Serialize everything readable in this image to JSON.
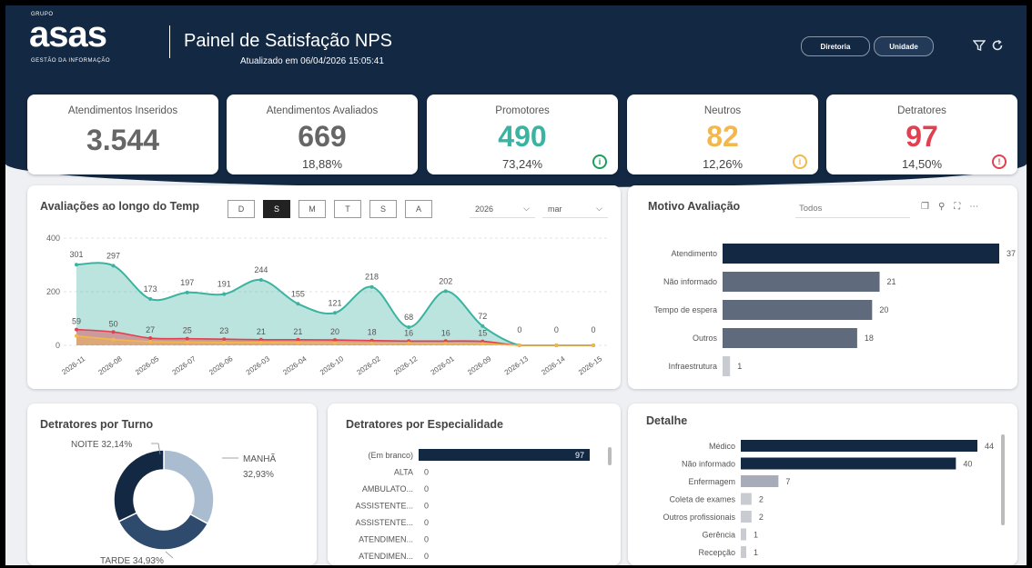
{
  "header": {
    "logo_group": "GRUPO",
    "logo_name": "asas",
    "logo_tagline": "GESTÃO DA INFORMAÇÃO",
    "title": "Painel de Satisfação NPS",
    "updated": "Atualizado em 06/04/2026 15:05:41",
    "buttons": [
      "Diretoria",
      "Unidade"
    ],
    "icons": [
      "filter-icon",
      "refresh-icon"
    ]
  },
  "kpis": [
    {
      "label": "Atendimentos Inseridos",
      "value": "3.544",
      "pct": "",
      "color": "#666666"
    },
    {
      "label": "Atendimentos Avaliados",
      "value": "669",
      "pct": "18,88%",
      "color": "#666666"
    },
    {
      "label": "Promotores",
      "value": "490",
      "pct": "73,24%",
      "color": "#3bb3a0",
      "icon": "info-icon"
    },
    {
      "label": "Neutros",
      "value": "82",
      "pct": "12,26%",
      "color": "#f2b84b",
      "icon": "info-icon"
    },
    {
      "label": "Detratores",
      "value": "97",
      "pct": "14,50%",
      "color": "#e0404f",
      "icon": "alert-icon"
    }
  ],
  "timeline": {
    "title": "Avaliações ao longo do Temp",
    "granularity": [
      "D",
      "S",
      "M",
      "T",
      "S",
      "A"
    ],
    "active_granularity": "S",
    "year": "2026",
    "month": "mar"
  },
  "motivo": {
    "title": "Motivo Avaliação",
    "filter": "Todos"
  },
  "turno": {
    "title": "Detratores por Turno"
  },
  "especialidade": {
    "title": "Detratores por Especialidade"
  },
  "detalhe": {
    "title": "Detalhe"
  },
  "chart_data": [
    {
      "type": "area",
      "title": "Avaliações ao longo do Temp",
      "categories": [
        "2026-11",
        "2026-08",
        "2026-05",
        "2026-07",
        "2026-06",
        "2026-03",
        "2026-04",
        "2026-10",
        "2026-02",
        "2026-12",
        "2026-01",
        "2026-09",
        "2026-13",
        "2026-14",
        "2026-15"
      ],
      "ylim": [
        0,
        400
      ],
      "yticks": [
        0,
        200,
        400
      ],
      "series": [
        {
          "values": [
            301,
            297,
            173,
            197,
            191,
            244,
            155,
            121,
            218,
            68,
            202,
            72,
            0,
            0,
            0
          ],
          "color": "#3bb3a0"
        },
        {
          "values": [
            59,
            50,
            27,
            25,
            23,
            21,
            21,
            20,
            18,
            16,
            16,
            15,
            0,
            0,
            0
          ],
          "color": "#e0404f"
        },
        {
          "values": [
            35,
            22,
            14,
            12,
            11,
            11,
            10,
            9,
            8,
            8,
            7,
            6,
            0,
            0,
            0
          ],
          "color": "#f2b84b"
        }
      ]
    },
    {
      "type": "bar",
      "title": "Motivo Avaliação",
      "categories": [
        "Atendimento",
        "Não informado",
        "Tempo de espera",
        "Outros",
        "Infraestrutura"
      ],
      "values": [
        37,
        21,
        20,
        18,
        1
      ],
      "colors": [
        "#132843",
        "#5f6b7d",
        "#5f6b7d",
        "#5f6b7d",
        "#c8cbd0"
      ]
    },
    {
      "type": "pie",
      "title": "Detratores por Turno",
      "categories": [
        "MANHÃ",
        "TARDE",
        "NOITE"
      ],
      "values": [
        32.93,
        34.93,
        32.14
      ],
      "labels": [
        "MANHÃ",
        "32,93%",
        "TARDE 34,93%",
        "NOITE 32,14%"
      ],
      "colors": [
        "#a9bcd0",
        "#2e4a6c",
        "#132843"
      ]
    },
    {
      "type": "bar",
      "title": "Detratores por Especialidade",
      "categories": [
        "(Em branco)",
        "ALTA",
        "AMBULATO...",
        "ASSISTENTE...",
        "ASSISTENTE...",
        "ATENDIMEN...",
        "ATENDIMEN..."
      ],
      "values": [
        97,
        0,
        0,
        0,
        0,
        0,
        0
      ],
      "colors": [
        "#132843"
      ]
    },
    {
      "type": "bar",
      "title": "Detalhe",
      "categories": [
        "Médico",
        "Não informado",
        "Enfermagem",
        "Coleta de exames",
        "Outros profissionais",
        "Gerência",
        "Recepção"
      ],
      "values": [
        44,
        40,
        7,
        2,
        2,
        1,
        1
      ],
      "colors": [
        "#132843",
        "#132843",
        "#a6adb8",
        "#c8cbd0",
        "#c8cbd0",
        "#c8cbd0",
        "#c8cbd0"
      ]
    }
  ]
}
